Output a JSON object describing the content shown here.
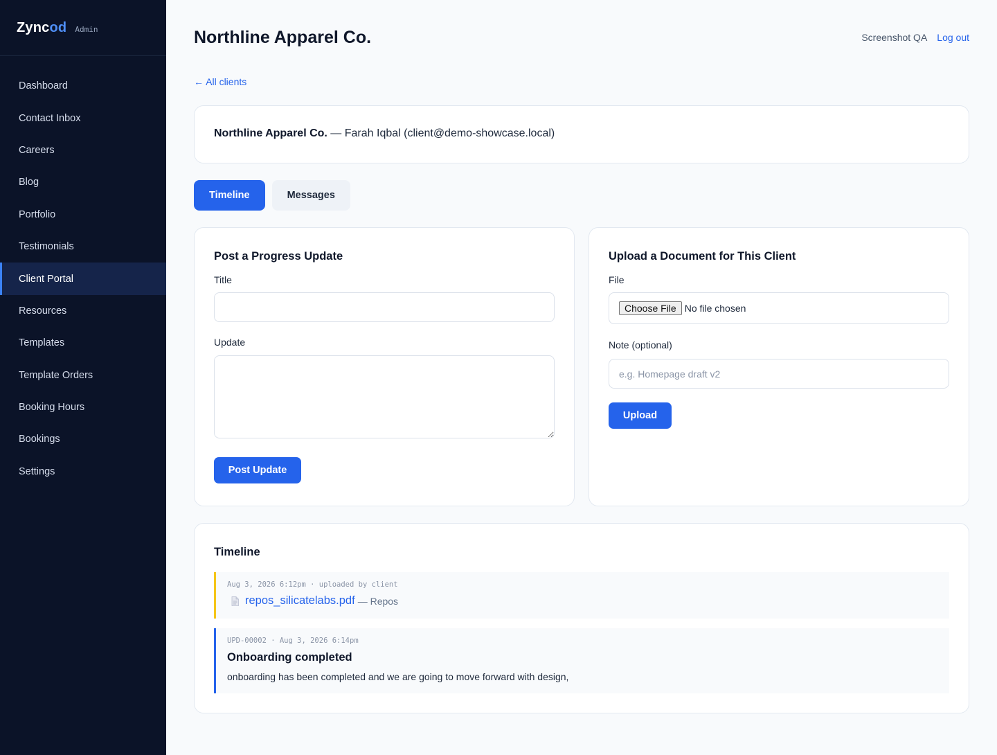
{
  "brand": {
    "name_main": "Zync",
    "name_accent": "od",
    "tag": "Admin"
  },
  "sidebar": {
    "items": [
      {
        "label": "Dashboard"
      },
      {
        "label": "Contact Inbox"
      },
      {
        "label": "Careers"
      },
      {
        "label": "Blog"
      },
      {
        "label": "Portfolio"
      },
      {
        "label": "Testimonials"
      },
      {
        "label": "Client Portal"
      },
      {
        "label": "Resources"
      },
      {
        "label": "Templates"
      },
      {
        "label": "Template Orders"
      },
      {
        "label": "Booking Hours"
      },
      {
        "label": "Bookings"
      },
      {
        "label": "Settings"
      }
    ],
    "active": "Client Portal"
  },
  "header": {
    "title": "Northline Apparel Co.",
    "user": "Screenshot QA",
    "logout": "Log out"
  },
  "back_link": "← All clients",
  "client": {
    "name": "Northline Apparel Co.",
    "details": " — Farah Iqbal (client@demo-showcase.local)"
  },
  "tabs": [
    {
      "label": "Timeline",
      "active": true
    },
    {
      "label": "Messages",
      "active": false
    }
  ],
  "progress_form": {
    "title": "Post a Progress Update",
    "title_label": "Title",
    "title_value": "",
    "update_label": "Update",
    "update_value": "",
    "submit": "Post Update"
  },
  "upload_form": {
    "title": "Upload a Document for This Client",
    "file_label": "File",
    "choose_file": "Choose File",
    "no_file": "No file chosen",
    "note_label": "Note (optional)",
    "note_placeholder": "e.g. Homepage draft v2",
    "submit": "Upload"
  },
  "timeline": {
    "title": "Timeline",
    "items": [
      {
        "type": "document",
        "meta": "Aug 3, 2026 6:12pm · uploaded by client",
        "file": "repos_silicatelabs.pdf",
        "note": "— Repos",
        "accent": "#f5c518"
      },
      {
        "type": "update",
        "meta": "UPD-00002 · Aug 3, 2026 6:14pm",
        "title": "Onboarding completed",
        "body": "onboarding has been completed and we are going to move forward with design,",
        "accent": "#2563eb"
      }
    ]
  },
  "colors": {
    "accent": "#2563eb",
    "sidebar_bg": "#0b1328",
    "page_bg": "#f8fafc"
  }
}
